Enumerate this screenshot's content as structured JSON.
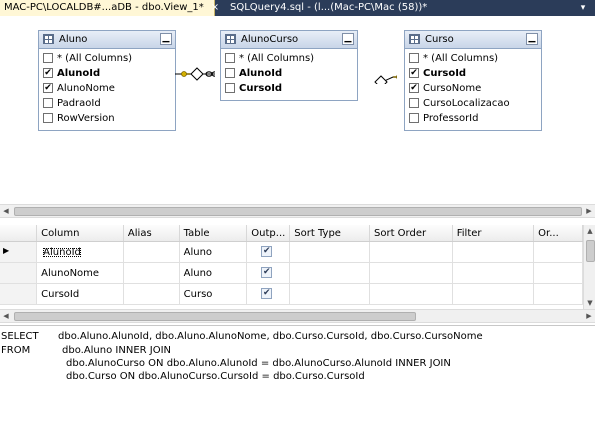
{
  "tabs": [
    {
      "label": "MAC-PC\\LOCALDB#...aDB - dbo.View_1*",
      "active": true
    },
    {
      "label": "SQLQuery4.sql - (l...(Mac-PC\\Mac (58))*",
      "active": false
    }
  ],
  "tab_close_glyph": "×",
  "tab_drop_glyph": "▾",
  "diagram": {
    "tables": [
      {
        "name": "Aluno",
        "columns": [
          {
            "label": "* (All Columns)",
            "checked": false,
            "key": false
          },
          {
            "label": "AlunoId",
            "checked": true,
            "key": true
          },
          {
            "label": "AlunoNome",
            "checked": true,
            "key": false
          },
          {
            "label": "PadraoId",
            "checked": false,
            "key": false
          },
          {
            "label": "RowVersion",
            "checked": false,
            "key": false
          }
        ]
      },
      {
        "name": "AlunoCurso",
        "columns": [
          {
            "label": "* (All Columns)",
            "checked": false,
            "key": false
          },
          {
            "label": "AlunoId",
            "checked": false,
            "key": true
          },
          {
            "label": "CursoId",
            "checked": false,
            "key": true
          }
        ]
      },
      {
        "name": "Curso",
        "columns": [
          {
            "label": "* (All Columns)",
            "checked": false,
            "key": false
          },
          {
            "label": "CursoId",
            "checked": true,
            "key": true
          },
          {
            "label": "CursoNome",
            "checked": true,
            "key": false
          },
          {
            "label": "CursoLocalizacao",
            "checked": false,
            "key": false
          },
          {
            "label": "ProfessorId",
            "checked": false,
            "key": false
          }
        ]
      }
    ],
    "minimize_glyph": "▁",
    "check_glyph": "✔"
  },
  "grid": {
    "headers": [
      "Column",
      "Alias",
      "Table",
      "Outp...",
      "Sort Type",
      "Sort Order",
      "Filter",
      "Or..."
    ],
    "rows": [
      {
        "column": "AlunoId",
        "alias": "",
        "table": "Aluno",
        "output": true
      },
      {
        "column": "AlunoNome",
        "alias": "",
        "table": "Aluno",
        "output": true
      },
      {
        "column": "CursoId",
        "alias": "",
        "table": "Curso",
        "output": true
      }
    ],
    "current_row_glyph": "▶"
  },
  "sql": {
    "lines": [
      {
        "keyword": "SELECT",
        "text": "dbo.Aluno.AlunoId, dbo.Aluno.AlunoNome, dbo.Curso.CursoId, dbo.Curso.CursoNome"
      },
      {
        "keyword": "FROM",
        "text": "dbo.Aluno INNER JOIN"
      },
      {
        "keyword": "",
        "text": "dbo.AlunoCurso ON dbo.Aluno.AlunoId = dbo.AlunoCurso.AlunoId INNER JOIN"
      },
      {
        "keyword": "",
        "text": "dbo.Curso ON dbo.AlunoCurso.CursoId = dbo.Curso.CursoId"
      }
    ]
  }
}
